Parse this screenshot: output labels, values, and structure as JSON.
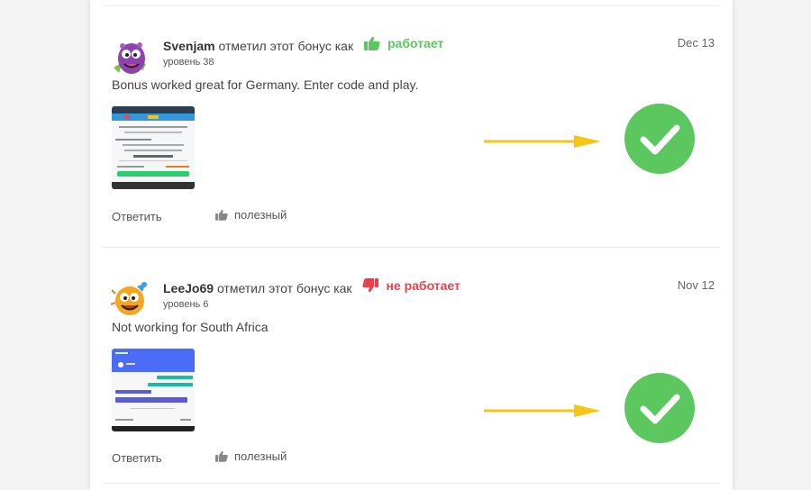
{
  "reviews": [
    {
      "user": "Svenjam",
      "action": "отметил этот бонус как",
      "verdict": "работает",
      "verdict_type": "works",
      "verdict_icon": "thumbs-up-icon",
      "verdict_color": "#5cc65f",
      "level": "уровень 38",
      "date": "Dec 13",
      "text": "Bonus worked great for Germany. Enter code and play.",
      "reply_label": "Ответить",
      "useful_label": "полезный"
    },
    {
      "user": "LeeJo69",
      "action": "отметил этот бонус как",
      "verdict": "не работает",
      "verdict_type": "not-works",
      "verdict_icon": "thumbs-down-icon",
      "verdict_color": "#ee3f4b",
      "level": "уровень 6",
      "date": "Nov 12",
      "text": "Not working for South Africa",
      "reply_label": "Ответить",
      "useful_label": "полезный"
    }
  ],
  "annotations": {
    "arrow_color": "#f5c518",
    "check_color": "#5cc65f",
    "icons": [
      "arrow-right-icon",
      "checkmark-circle-icon"
    ]
  }
}
